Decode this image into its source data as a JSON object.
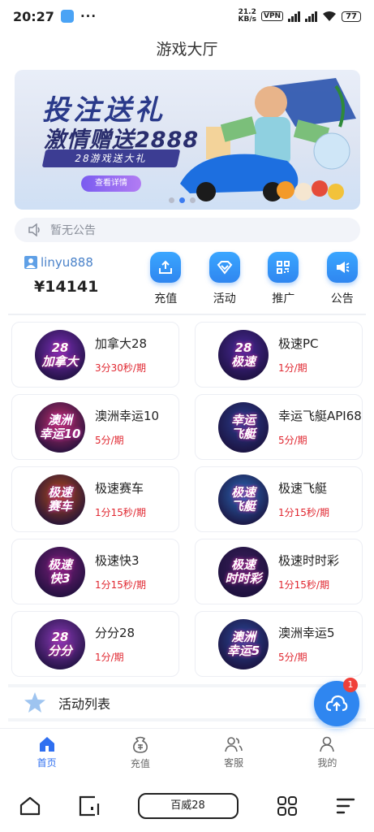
{
  "status_bar": {
    "time": "20:27",
    "dots": "···",
    "speed_value": "21.2",
    "speed_unit": "KB/s",
    "vpn": "VPN",
    "battery": "77"
  },
  "header": {
    "title": "游戏大厅"
  },
  "banner": {
    "title_line1": "投注送礼",
    "title_line2": "激情赠送2888",
    "subtitle": "28游戏送大礼",
    "detail_button": "查看详情",
    "active_dot": 2,
    "dot_count": 3
  },
  "notice": {
    "text": "暂无公告",
    "icon": "speaker-icon"
  },
  "user": {
    "name": "linyu888",
    "balance": "¥14141"
  },
  "actions": [
    {
      "label": "充值",
      "icon": "recharge-icon"
    },
    {
      "label": "活动",
      "icon": "activity-icon"
    },
    {
      "label": "推广",
      "icon": "promote-icon"
    },
    {
      "label": "公告",
      "icon": "announcement-icon"
    }
  ],
  "games": [
    {
      "name": "加拿大28",
      "period": "3分30秒/期",
      "logo": [
        "28",
        "加拿大"
      ],
      "color": "#7b2fb8"
    },
    {
      "name": "极速PC",
      "period": "1分/期",
      "logo": [
        "28",
        "极速"
      ],
      "color": "#4a2a9a"
    },
    {
      "name": "澳洲幸运10",
      "period": "5分/期",
      "logo": [
        "澳洲",
        "幸运10"
      ],
      "color": "#c0306a"
    },
    {
      "name": "幸运飞艇API68",
      "period": "5分/期",
      "logo": [
        "幸运",
        "飞艇"
      ],
      "color": "#2a3f8f"
    },
    {
      "name": "极速赛车",
      "period": "1分15秒/期",
      "logo": [
        "极速",
        "赛车"
      ],
      "color": "#b04a1a"
    },
    {
      "name": "极速飞艇",
      "period": "1分15秒/期",
      "logo": [
        "极速",
        "飞艇"
      ],
      "color": "#2a6ab8"
    },
    {
      "name": "极速快3",
      "period": "1分15秒/期",
      "logo": [
        "极速",
        "快3"
      ],
      "color": "#7a1f7a"
    },
    {
      "name": "极速时时彩",
      "period": "1分15秒/期",
      "logo": [
        "极速",
        "时时彩"
      ],
      "color": "#3a1f5a"
    },
    {
      "name": "分分28",
      "period": "1分/期",
      "logo": [
        "28",
        "分分"
      ],
      "color": "#8a3ab8"
    },
    {
      "name": "澳洲幸运5",
      "period": "5分/期",
      "logo": [
        "澳洲",
        "幸运5"
      ],
      "color": "#2a4a9a"
    }
  ],
  "activity": {
    "title": "活动列表",
    "fab_badge": "1"
  },
  "tabbar": [
    {
      "label": "首页",
      "icon": "home-icon",
      "active": true
    },
    {
      "label": "充值",
      "icon": "wallet-icon",
      "active": false
    },
    {
      "label": "客服",
      "icon": "support-icon",
      "active": false
    },
    {
      "label": "我的",
      "icon": "profile-icon",
      "active": false
    }
  ],
  "system_nav": {
    "app_label": "百威28"
  },
  "colors": {
    "accent": "#2f86f0",
    "period_red": "#e0262f",
    "active_tab": "#2f6ff0"
  }
}
